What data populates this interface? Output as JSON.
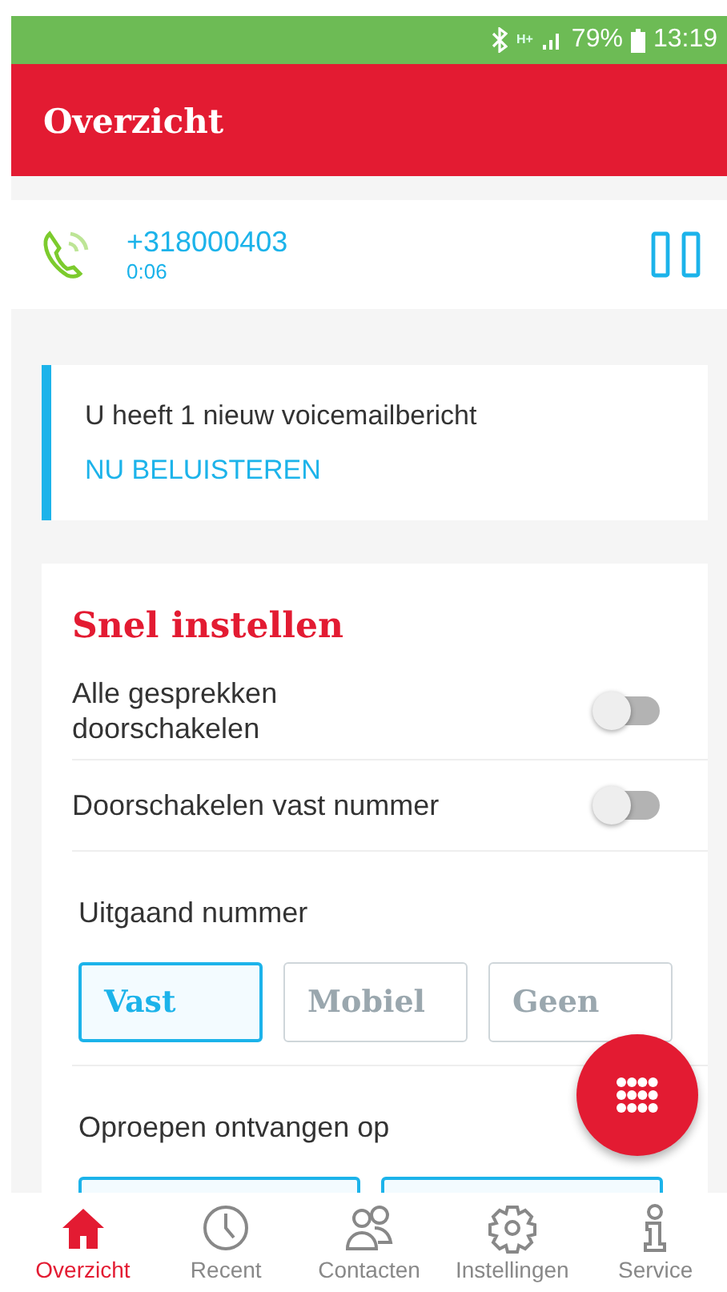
{
  "status_bar": {
    "network": "H+",
    "battery": "79%",
    "time": "13:19"
  },
  "header": {
    "title": "Overzicht"
  },
  "call": {
    "number": "+318000403",
    "duration": "0:06"
  },
  "voicemail": {
    "message": "U heeft 1 nieuw voicemailbericht",
    "action": "NU BELUISTEREN"
  },
  "quick_settings": {
    "title": "Snel instellen",
    "toggles": [
      {
        "label": "Alle gesprekken doorschakelen",
        "on": false
      },
      {
        "label": "Doorschakelen vast nummer",
        "on": false
      }
    ],
    "outgoing": {
      "label": "Uitgaand nummer",
      "options": [
        {
          "label": "Vast",
          "selected": true
        },
        {
          "label": "Mobiel",
          "selected": false
        },
        {
          "label": "Geen",
          "selected": false
        }
      ]
    },
    "receive": {
      "label": "Oproepen ontvangen op"
    }
  },
  "bottom_nav": [
    {
      "label": "Overzicht",
      "selected": true
    },
    {
      "label": "Recent",
      "selected": false
    },
    {
      "label": "Contacten",
      "selected": false
    },
    {
      "label": "Instellingen",
      "selected": false
    },
    {
      "label": "Service",
      "selected": false
    }
  ]
}
